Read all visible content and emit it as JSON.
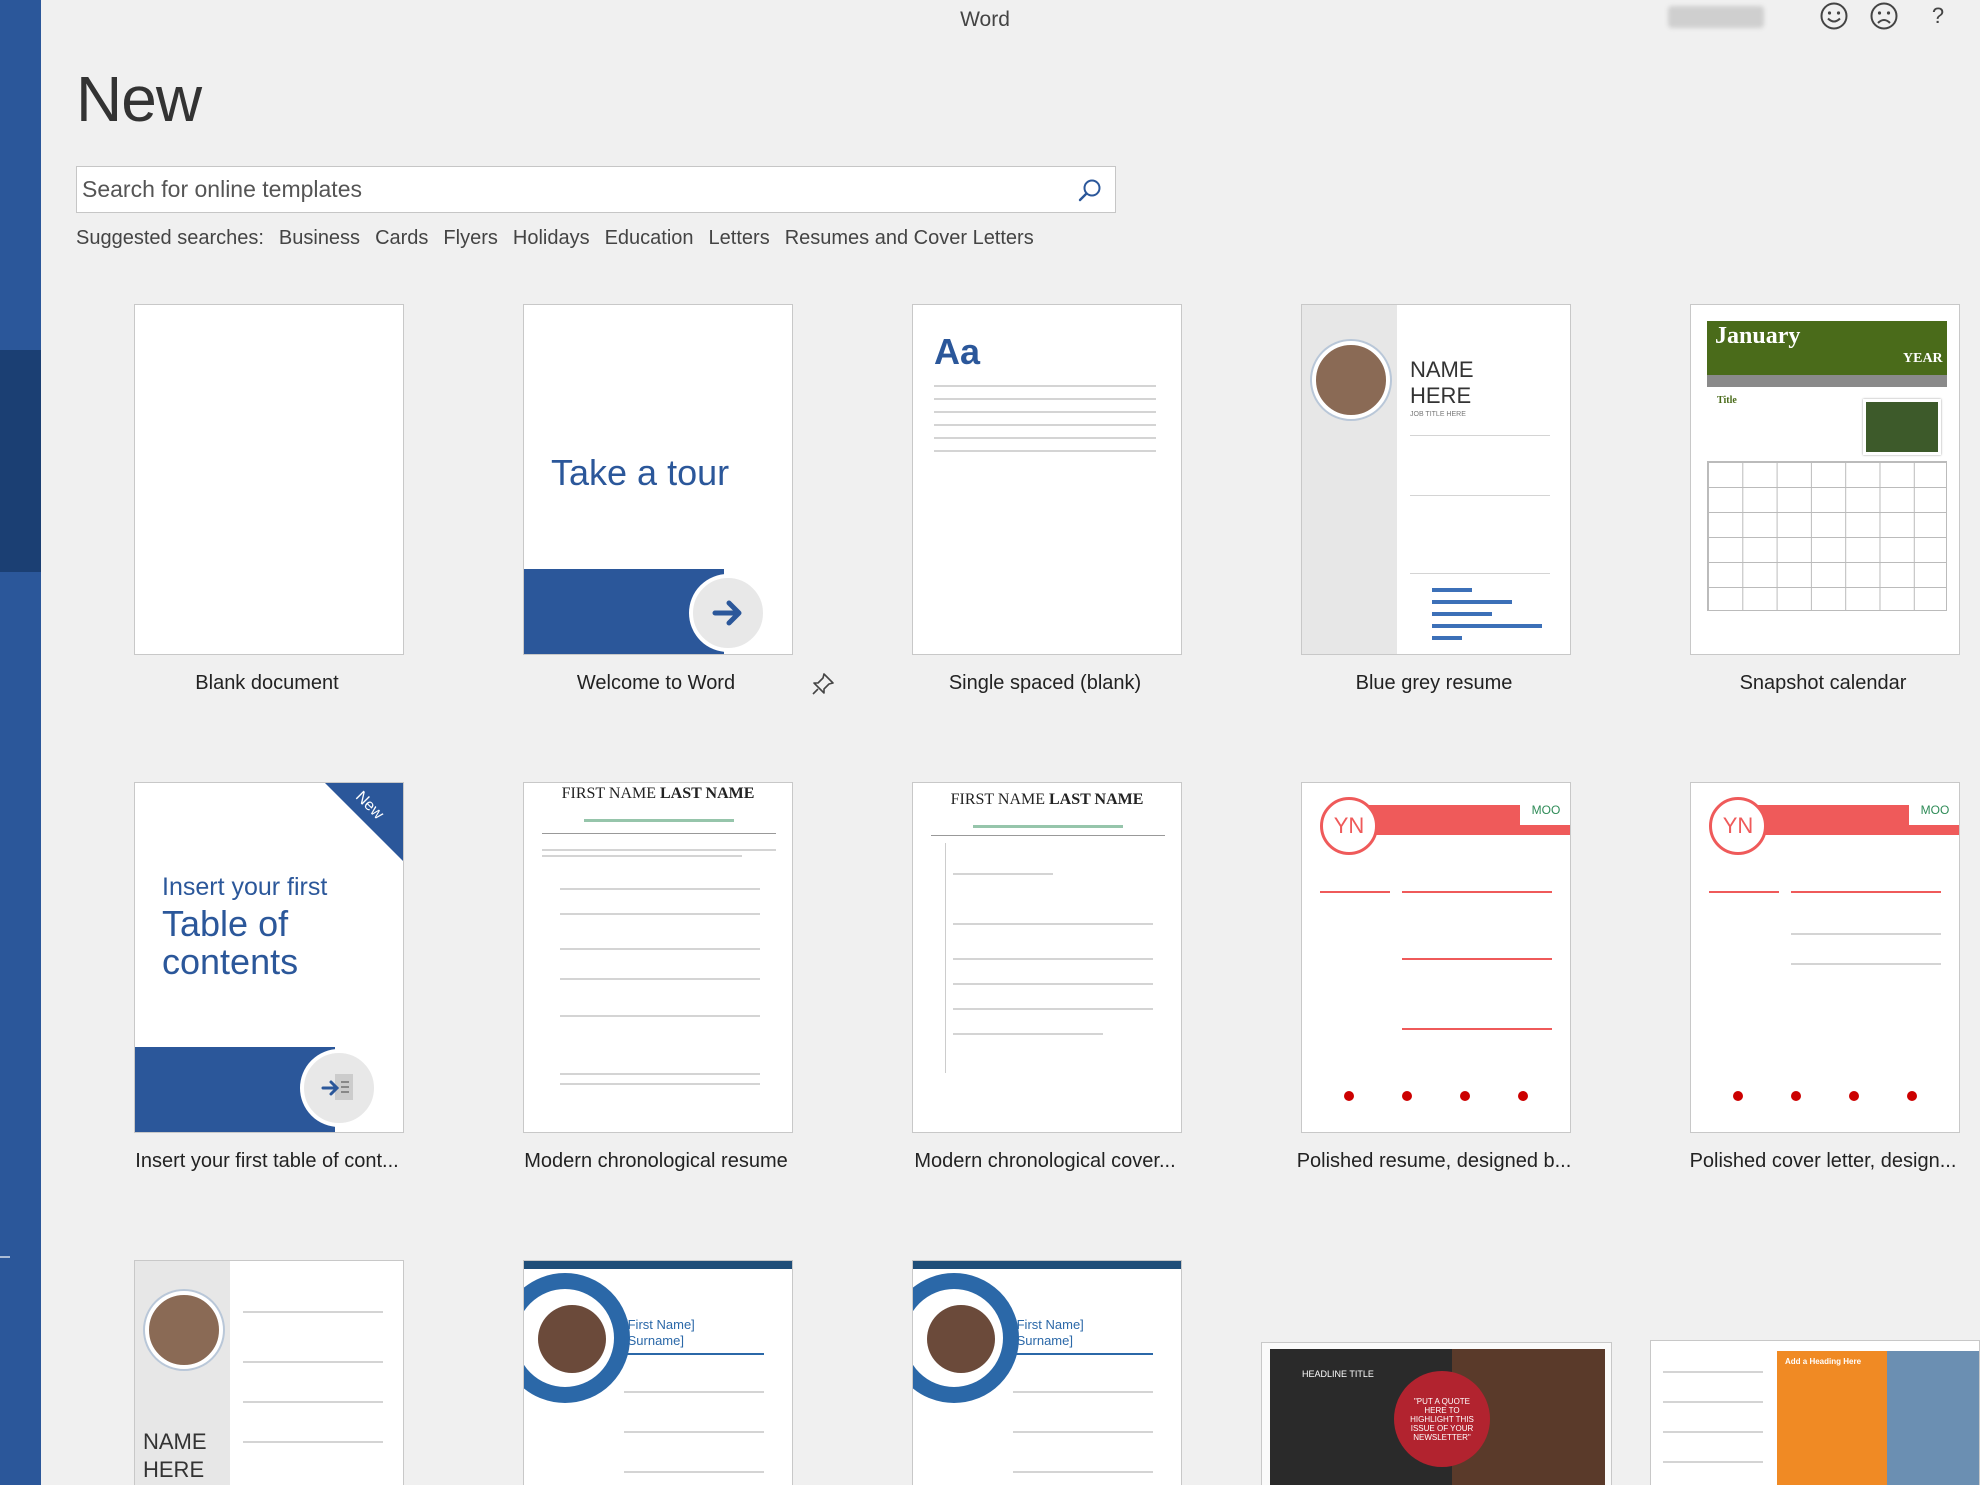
{
  "window": {
    "title": "Word"
  },
  "titlebar": {
    "smile_icon": "smile-icon",
    "frown_icon": "frown-icon",
    "help_label": "?"
  },
  "page": {
    "title": "New"
  },
  "search": {
    "placeholder": "Search for online templates",
    "value": ""
  },
  "suggested": {
    "label": "Suggested searches:",
    "links": [
      "Business",
      "Cards",
      "Flyers",
      "Holidays",
      "Education",
      "Letters",
      "Resumes and Cover Letters"
    ]
  },
  "templates": [
    {
      "label": "Blank document"
    },
    {
      "label": "Welcome to Word",
      "thumb_text": "Take a tour",
      "pin_icon": "pin-icon"
    },
    {
      "label": "Single spaced (blank)",
      "thumb_text": "Aa"
    },
    {
      "label": "Blue grey resume",
      "thumb_name_1": "NAME",
      "thumb_name_2": "HERE",
      "thumb_sub": "JOB TITLE HERE"
    },
    {
      "label": "Snapshot calendar",
      "thumb_month": "January",
      "thumb_year": "YEAR",
      "thumb_title": "Title"
    },
    {
      "label": "Insert your first table of cont...",
      "ribbon": "New",
      "thumb_line1": "Insert your first",
      "thumb_line2": "Table of",
      "thumb_line3": "contents"
    },
    {
      "label": "Modern chronological resume",
      "thumb_first": "FIRST NAME ",
      "thumb_last": "LAST NAME"
    },
    {
      "label": "Modern chronological cover...",
      "thumb_first": "FIRST NAME ",
      "thumb_last": "LAST NAME"
    },
    {
      "label": "Polished resume, designed b...",
      "thumb_initials": "YN",
      "thumb_brand": "MOO"
    },
    {
      "label": "Polished cover letter, design...",
      "thumb_initials": "YN",
      "thumb_brand": "MOO"
    },
    {
      "label": "",
      "thumb_name_1": "NAME",
      "thumb_name_2": "HERE"
    },
    {
      "label": "",
      "thumb_first": "[First Name]",
      "thumb_last": "[Surname]"
    },
    {
      "label": "",
      "thumb_first": "[First Name]",
      "thumb_last": "[Surname]"
    },
    {
      "label": "",
      "thumb_headline": "HEADLINE TITLE",
      "thumb_quote": "\"PUT A QUOTE HERE TO HIGHLIGHT THIS ISSUE OF YOUR NEWSLETTER\""
    },
    {
      "label": "",
      "thumb_heading": "Add a Heading Here"
    }
  ],
  "colors": {
    "accent": "#2b579a",
    "background": "#f0f0f0",
    "calendar_green": "#4a6b1a",
    "moo_red": "#ef5a5a"
  }
}
